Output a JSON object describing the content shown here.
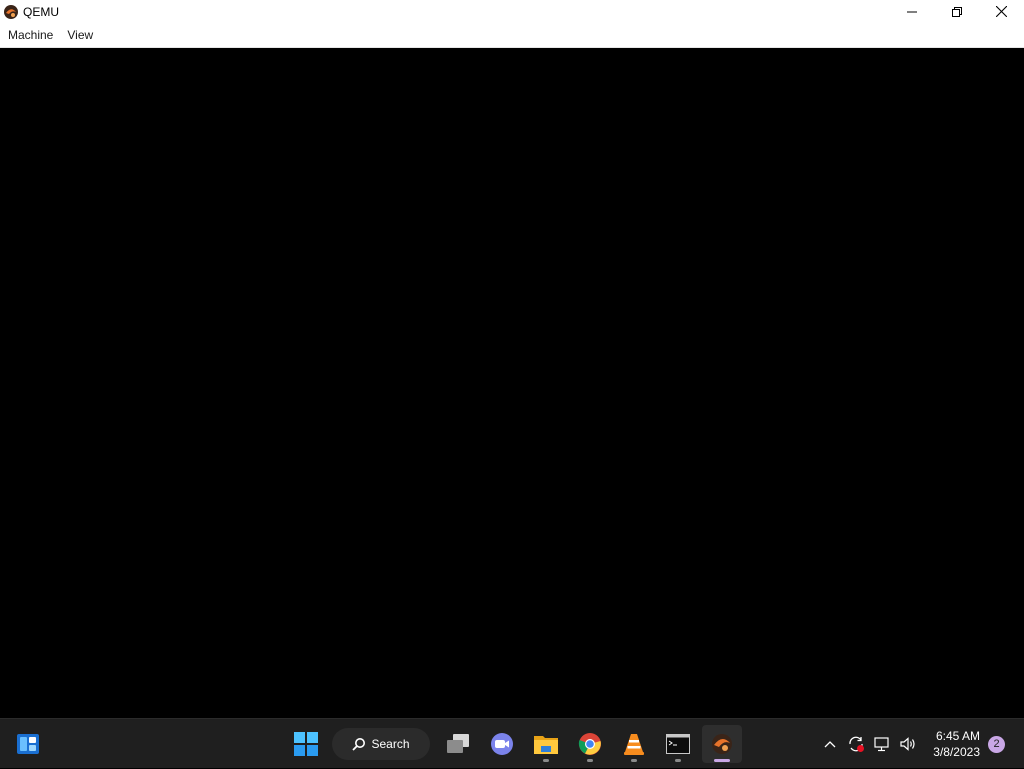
{
  "window": {
    "title": "QEMU",
    "app_icon": "qemu-icon",
    "controls": [
      "minimize-icon",
      "restore-icon",
      "close-icon"
    ]
  },
  "menu": {
    "items": [
      {
        "label": "Machine"
      },
      {
        "label": "View"
      }
    ]
  },
  "taskbar": {
    "search_label": "Search",
    "apps": [
      {
        "name": "widgets-icon"
      },
      {
        "name": "start-icon"
      },
      {
        "name": "search-icon"
      },
      {
        "name": "task-view-icon"
      },
      {
        "name": "teams-meet-icon"
      },
      {
        "name": "file-explorer-icon",
        "running": true
      },
      {
        "name": "chrome-icon",
        "running": true
      },
      {
        "name": "vlc-icon",
        "running": true
      },
      {
        "name": "terminal-icon",
        "running": true
      },
      {
        "name": "qemu-icon",
        "running": true,
        "active": true
      }
    ],
    "tray": {
      "icons": [
        "chevron-up-icon",
        "sync-icon",
        "network-icon",
        "volume-icon"
      ],
      "time": "6:45 AM",
      "date": "3/8/2023",
      "notification_count": "2"
    }
  },
  "colors": {
    "accent": "#c9a7e6",
    "taskbar_bg": "#1f1f1f",
    "screen_bg": "#000000"
  }
}
